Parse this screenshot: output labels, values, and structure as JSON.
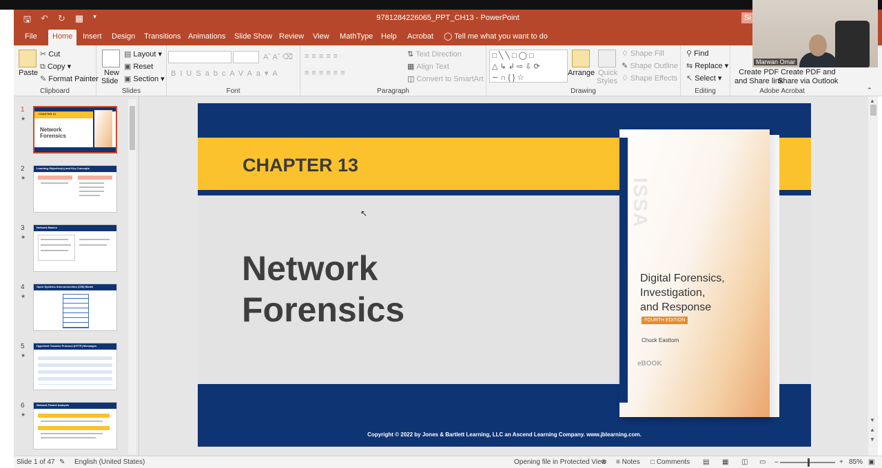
{
  "window": {
    "doc_title": "9781284226065_PPT_CH13  -  PowerPoint",
    "signin": "Si"
  },
  "tabs": [
    "File",
    "Home",
    "Insert",
    "Design",
    "Transitions",
    "Animations",
    "Slide Show",
    "Review",
    "View",
    "MathType",
    "Help",
    "Acrobat"
  ],
  "tell_me": "Tell me what you want to do",
  "ribbon": {
    "clipboard": {
      "paste": "Paste",
      "cut": "Cut",
      "copy": "Copy",
      "format_painter": "Format Painter",
      "label": "Clipboard"
    },
    "slides": {
      "new_slide_1": "New",
      "new_slide_2": "Slide",
      "layout": "Layout",
      "reset": "Reset",
      "section": "Section",
      "label": "Slides"
    },
    "font": {
      "label": "Font"
    },
    "paragraph": {
      "text_direction": "Text Direction",
      "align_text": "Align Text",
      "convert_smartart": "Convert to SmartArt",
      "label": "Paragraph"
    },
    "drawing": {
      "arrange": "Arrange",
      "quick_styles_1": "Quick",
      "quick_styles_2": "Styles",
      "shape_fill": "Shape Fill",
      "shape_outline": "Shape Outline",
      "shape_effects": "Shape Effects",
      "label": "Drawing"
    },
    "editing": {
      "find": "Find",
      "replace": "Replace",
      "select": "Select",
      "label": "Editing"
    },
    "acrobat": {
      "create_pdf_share_1": "Create PDF",
      "create_pdf_share_2": "and Share link",
      "create_pdf_outlook_1": "Create PDF and",
      "create_pdf_outlook_2": "Share via Outlook",
      "label": "Adobe Acrobat"
    }
  },
  "webcam": {
    "name": "Marwan Omar"
  },
  "thumbnails": [
    {
      "num": "1",
      "title": "CHAPTER 13",
      "subtitle": "Network Forensics"
    },
    {
      "num": "2",
      "title": "Learning Objective(s) and Key Concepts"
    },
    {
      "num": "3",
      "title": "Network Basics"
    },
    {
      "num": "4",
      "title": "Open Systems Interconnection (OSI) Model"
    },
    {
      "num": "5",
      "title": "Hypertext Transfer Protocol (HTTP) Messages"
    },
    {
      "num": "6",
      "title": "Network Packet Analysis"
    }
  ],
  "slide": {
    "chapter": "CHAPTER 13",
    "title_line1": "Network",
    "title_line2": "Forensics",
    "copyright": "Copyright © 2022 by Jones & Bartlett Learning, LLC an Ascend Learning Company. www.jblearning.com.",
    "book": {
      "series": "ISSA",
      "title_line1": "Digital Forensics,",
      "title_line2": "Investigation,",
      "title_line3": "and Response",
      "edition": "FOURTH EDITION",
      "author": "Chuck Easttom",
      "badge": "eBOOK"
    }
  },
  "status": {
    "slide_of": "Slide 1 of 47",
    "language": "English (United States)",
    "protected": "Opening file in Protected View",
    "notes": "Notes",
    "comments": "Comments",
    "zoom": "85%"
  }
}
